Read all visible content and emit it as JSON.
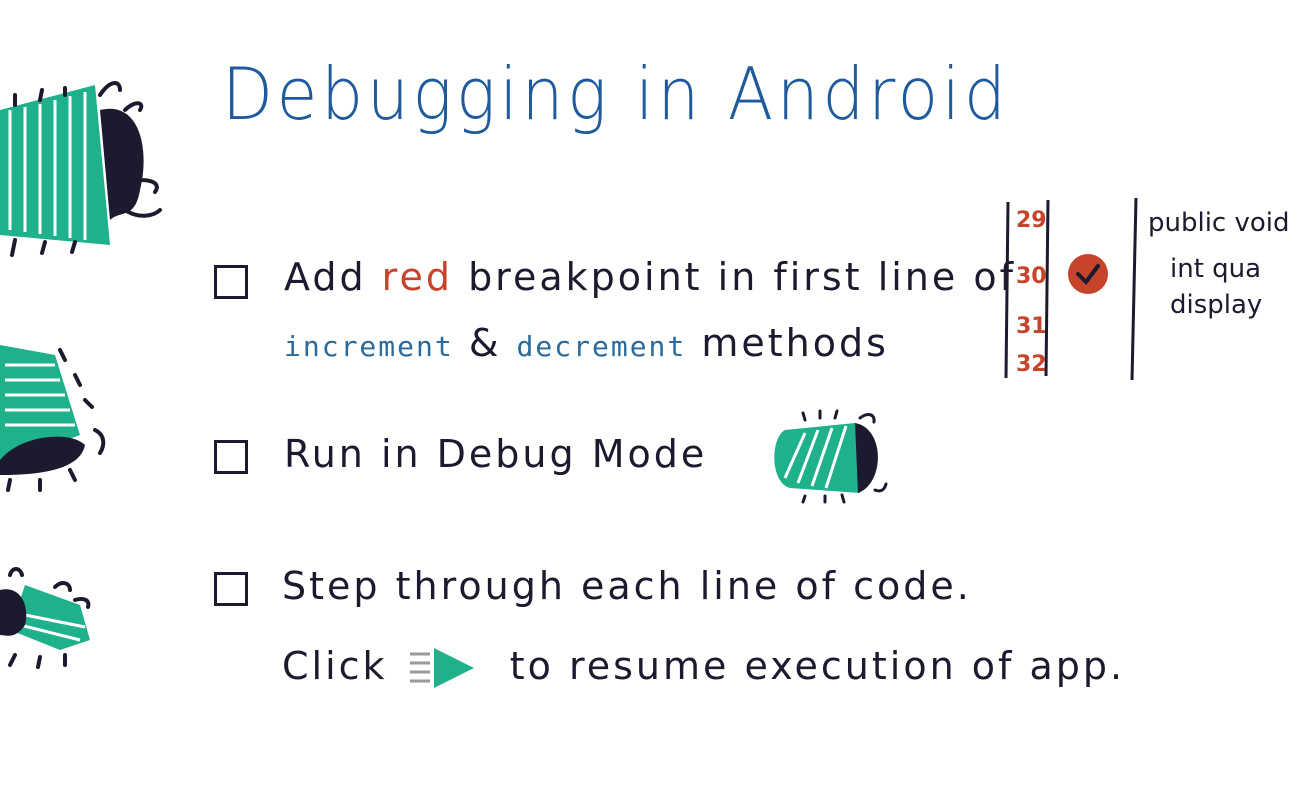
{
  "title": "Debugging in Android",
  "colors": {
    "title": "#1f5a9c",
    "red": "#c5442b",
    "teal": "#1fb08c",
    "ink": "#1b1a2e",
    "code_blue": "#2a6a9c"
  },
  "steps": [
    {
      "line1": {
        "prefix": "Add",
        "highlight": "red",
        "suffix": "breakpoint in first line of"
      },
      "line2": {
        "method1": "increment",
        "amp": "&",
        "method2": "decrement",
        "suffix": "methods"
      }
    },
    {
      "text": "Run in Debug Mode"
    },
    {
      "line1": "Step through each line of code.",
      "line2": {
        "prefix": "Click",
        "suffix": "to resume execution of app."
      }
    }
  ],
  "code_snippet": {
    "line_numbers": [
      "29",
      "30",
      "31",
      "32"
    ],
    "lines": [
      "public void",
      "int qua",
      "display"
    ]
  },
  "icons": {
    "bug": "bug-icon",
    "checkbox": "checkbox-icon",
    "resume": "resume-execution-icon",
    "breakpoint": "breakpoint-check-icon"
  }
}
